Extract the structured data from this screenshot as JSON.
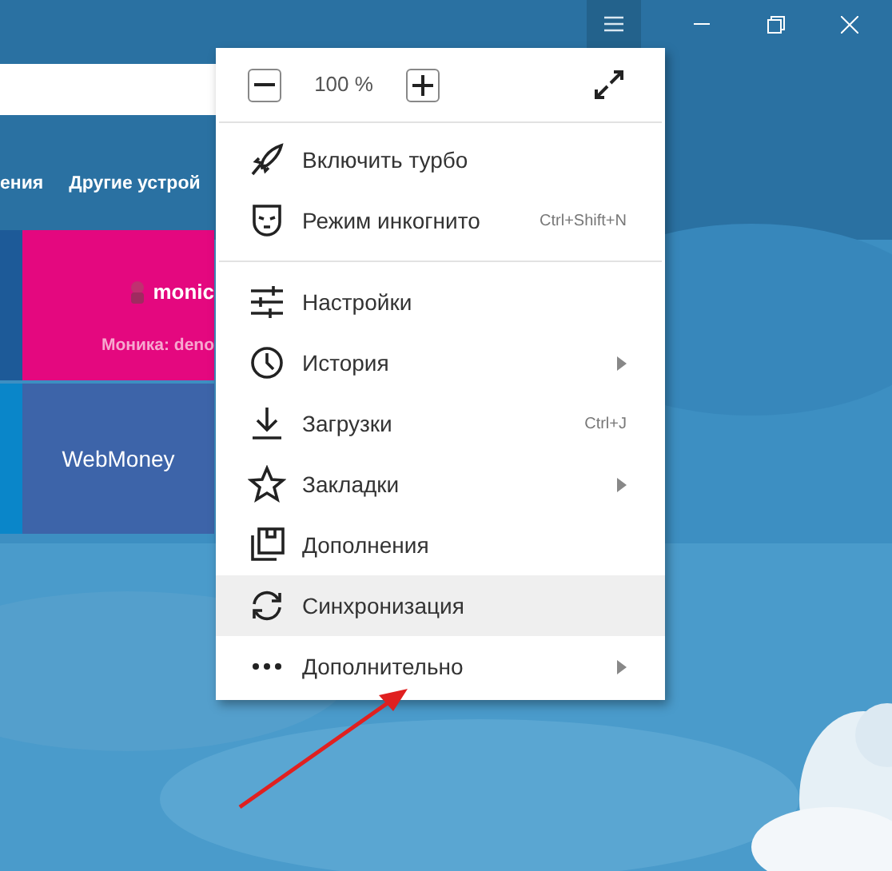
{
  "nav_links": [
    "ения",
    "Другие устрой"
  ],
  "tiles": [
    [
      {
        "kind": "edge",
        "color": "#1d5a98"
      },
      {
        "kind": "logo",
        "title": "monic",
        "subtitle": "Моника: deno",
        "color": "#e4087f"
      }
    ],
    [
      {
        "kind": "edge",
        "color": "#0a86c9"
      },
      {
        "kind": "text",
        "title": "WebMoney",
        "color": "#3d64a9"
      }
    ]
  ],
  "menu": {
    "zoom": {
      "value": "100 %"
    },
    "sections": [
      [
        {
          "label": "Включить турбо",
          "submenu": false,
          "selected": false
        },
        {
          "label": "Режим инкогнито",
          "shortcut": "Ctrl+Shift+N",
          "submenu": false,
          "selected": false
        }
      ],
      [
        {
          "label": "Настройки",
          "submenu": false,
          "selected": false
        },
        {
          "label": "История",
          "submenu": true,
          "selected": false
        },
        {
          "label": "Загрузки",
          "shortcut": "Ctrl+J",
          "submenu": false,
          "selected": false
        },
        {
          "label": "Закладки",
          "submenu": true,
          "selected": false
        },
        {
          "label": "Дополнения",
          "submenu": false,
          "selected": false
        },
        {
          "label": "Синхронизация",
          "submenu": false,
          "selected": true
        },
        {
          "label": "Дополнительно",
          "submenu": true,
          "selected": false
        }
      ]
    ]
  }
}
